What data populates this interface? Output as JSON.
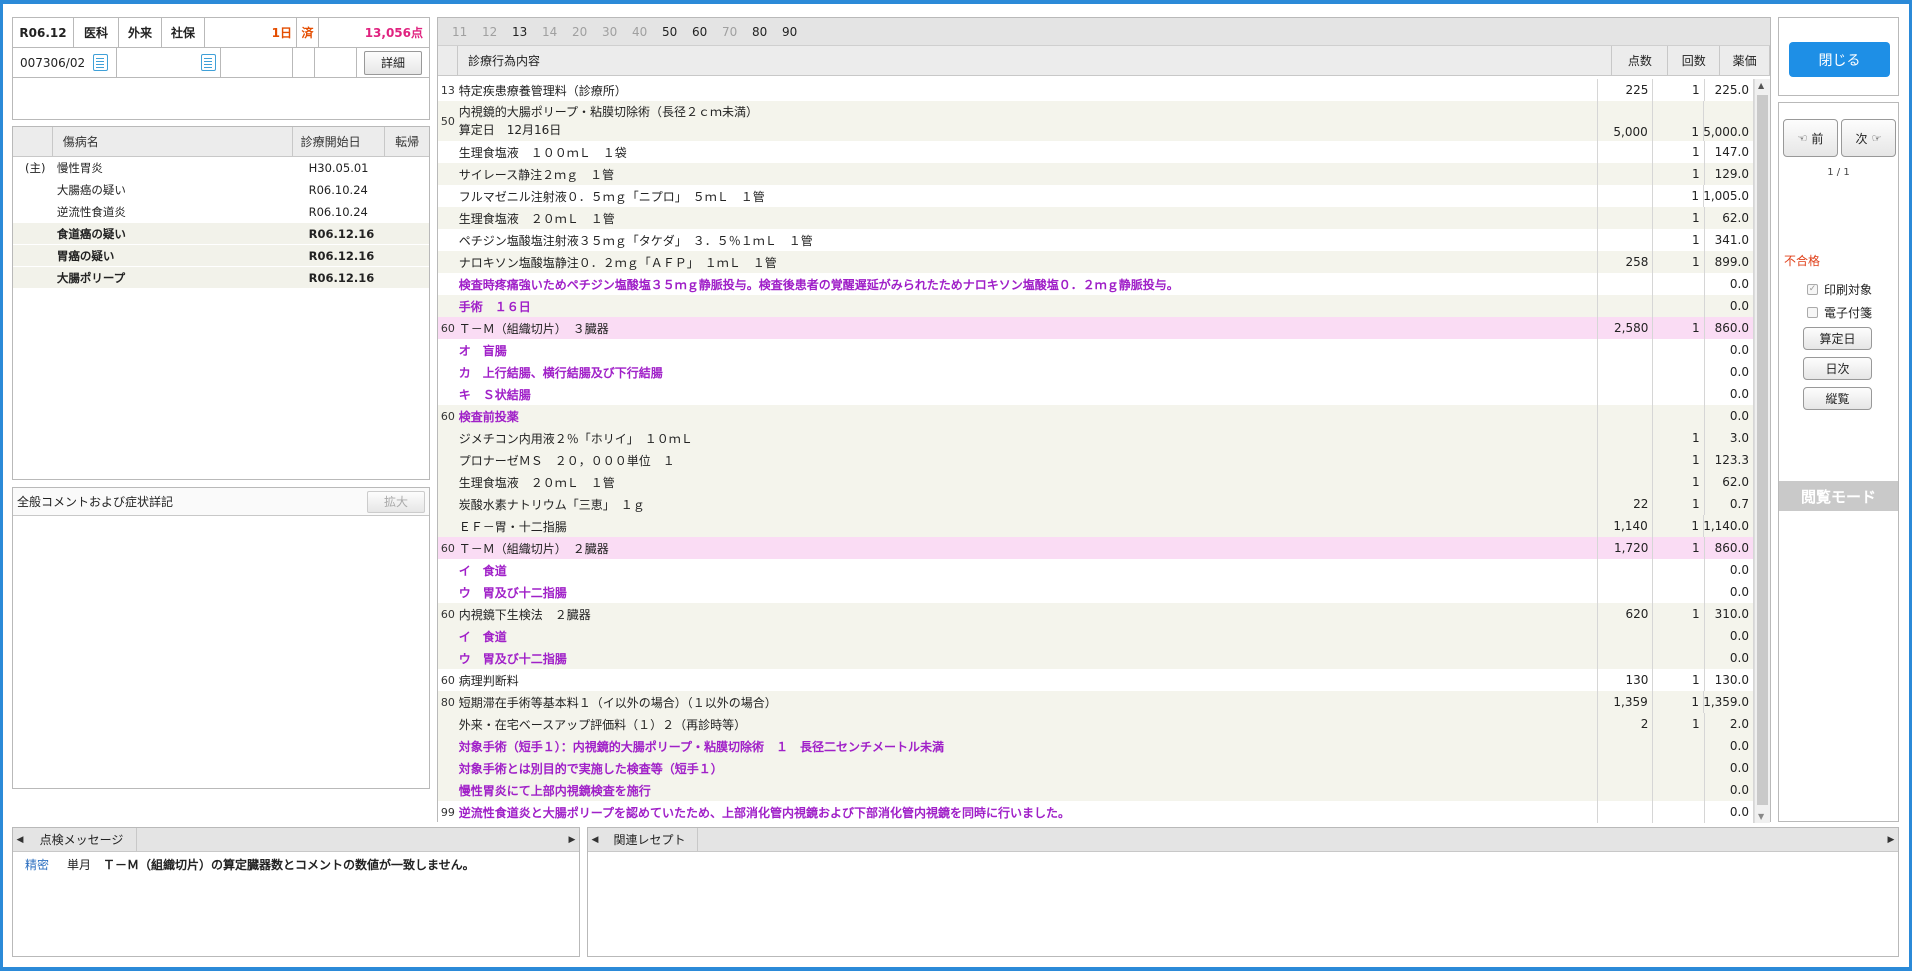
{
  "header": {
    "date": "R06.12",
    "dept": "医科",
    "type": "外来",
    "insurance": "社保",
    "days": "1日",
    "status": "済",
    "points": "13,056点",
    "patient_id": "007306/02",
    "detail_button": "詳細"
  },
  "disease_panel": {
    "col_name": "傷病名",
    "col_start": "診療開始日",
    "col_outcome": "転帰",
    "rows": [
      {
        "main": "(主)",
        "name": "慢性胃炎",
        "date": "H30.05.01",
        "bold": false
      },
      {
        "main": "",
        "name": "大腸癌の疑い",
        "date": "R06.10.24",
        "bold": false
      },
      {
        "main": "",
        "name": "逆流性食道炎",
        "date": "R06.10.24",
        "bold": false
      },
      {
        "main": "",
        "name": "食道癌の疑い",
        "date": "R06.12.16",
        "bold": true
      },
      {
        "main": "",
        "name": "胃癌の疑い",
        "date": "R06.12.16",
        "bold": true
      },
      {
        "main": "",
        "name": "大腸ポリープ",
        "date": "R06.12.16",
        "bold": true
      }
    ]
  },
  "comment_panel": {
    "title": "全般コメントおよび症状詳記",
    "expand_button": "拡大"
  },
  "day_tabs": [
    "11",
    "12",
    "13",
    "14",
    "20",
    "30",
    "40",
    "50",
    "60",
    "70",
    "80",
    "90"
  ],
  "main_table": {
    "col_content": "診療行為内容",
    "col_points": "点数",
    "col_count": "回数",
    "col_price": "薬価",
    "rows": [
      {
        "code": "13",
        "text": "特定疾患療養管理料（診療所）",
        "line2": "",
        "pts": "225",
        "cnt": "1",
        "price": "225.0",
        "style": "b",
        "comment": false
      },
      {
        "code": "50",
        "text": "内視鏡的大腸ポリープ・粘膜切除術（長径２ｃｍ未満）",
        "line2": "算定日　12月16日",
        "pts": "5,000",
        "cnt": "1",
        "price": "5,000.0",
        "style": "a",
        "comment": false
      },
      {
        "code": "",
        "text": "生理食塩液　１００ｍＬ　１袋",
        "line2": "",
        "pts": "",
        "cnt": "1",
        "price": "147.0",
        "style": "b",
        "comment": false
      },
      {
        "code": "",
        "text": "サイレース静注２ｍｇ　１管",
        "line2": "",
        "pts": "",
        "cnt": "1",
        "price": "129.0",
        "style": "a",
        "comment": false
      },
      {
        "code": "",
        "text": "フルマゼニル注射液０．５ｍｇ「ニプロ」　５ｍＬ　１管",
        "line2": "",
        "pts": "",
        "cnt": "1",
        "price": "1,005.0",
        "style": "b",
        "comment": false
      },
      {
        "code": "",
        "text": "生理食塩液　２０ｍＬ　１管",
        "line2": "",
        "pts": "",
        "cnt": "1",
        "price": "62.0",
        "style": "a",
        "comment": false
      },
      {
        "code": "",
        "text": "ペチジン塩酸塩注射液３５ｍｇ「タケダ」　３．５％１ｍＬ　１管",
        "line2": "",
        "pts": "",
        "cnt": "1",
        "price": "341.0",
        "style": "b",
        "comment": false
      },
      {
        "code": "",
        "text": "ナロキソン塩酸塩静注０．２ｍｇ「ＡＦＰ」　１ｍＬ　１管",
        "line2": "",
        "pts": "258",
        "cnt": "1",
        "price": "899.0",
        "style": "a",
        "comment": false
      },
      {
        "code": "",
        "text": "検査時疼痛強いためペチジン塩酸塩３５ｍｇ静脈投与。検査後患者の覚醒遅延がみられたためナロキソン塩酸塩０．２ｍｇ静脈投与。",
        "line2": "",
        "pts": "",
        "cnt": "",
        "price": "0.0",
        "style": "b",
        "comment": true
      },
      {
        "code": "",
        "text": "手術　１６日",
        "line2": "",
        "pts": "",
        "cnt": "",
        "price": "0.0",
        "style": "a",
        "comment": true
      },
      {
        "code": "60",
        "text": "Ｔ－Ｍ（組織切片）　３臓器",
        "line2": "",
        "pts": "2,580",
        "cnt": "1",
        "price": "860.0",
        "style": "p",
        "comment": false
      },
      {
        "code": "",
        "text": "オ　盲腸",
        "line2": "",
        "pts": "",
        "cnt": "",
        "price": "0.0",
        "style": "b",
        "comment": true
      },
      {
        "code": "",
        "text": "カ　上行結腸、横行結腸及び下行結腸",
        "line2": "",
        "pts": "",
        "cnt": "",
        "price": "0.0",
        "style": "b",
        "comment": true
      },
      {
        "code": "",
        "text": "キ　Ｓ状結腸",
        "line2": "",
        "pts": "",
        "cnt": "",
        "price": "0.0",
        "style": "b",
        "comment": true
      },
      {
        "code": "60",
        "text": "検査前投薬",
        "line2": "",
        "pts": "",
        "cnt": "",
        "price": "0.0",
        "style": "a",
        "comment": true
      },
      {
        "code": "",
        "text": "ジメチコン内用液２％「ホリイ」　１０ｍＬ",
        "line2": "",
        "pts": "",
        "cnt": "1",
        "price": "3.0",
        "style": "a",
        "comment": false
      },
      {
        "code": "",
        "text": "プロナーゼＭＳ　２０，０００単位　１",
        "line2": "",
        "pts": "",
        "cnt": "1",
        "price": "123.3",
        "style": "a",
        "comment": false
      },
      {
        "code": "",
        "text": "生理食塩液　２０ｍＬ　１管",
        "line2": "",
        "pts": "",
        "cnt": "1",
        "price": "62.0",
        "style": "a",
        "comment": false
      },
      {
        "code": "",
        "text": "炭酸水素ナトリウム「三恵」　１ｇ",
        "line2": "",
        "pts": "22",
        "cnt": "1",
        "price": "0.7",
        "style": "a",
        "comment": false
      },
      {
        "code": "",
        "text": "ＥＦ－胃・十二指腸",
        "line2": "",
        "pts": "1,140",
        "cnt": "1",
        "price": "1,140.0",
        "style": "a",
        "comment": false
      },
      {
        "code": "60",
        "text": "Ｔ－Ｍ（組織切片）　２臓器",
        "line2": "",
        "pts": "1,720",
        "cnt": "1",
        "price": "860.0",
        "style": "p",
        "comment": false
      },
      {
        "code": "",
        "text": "イ　食道",
        "line2": "",
        "pts": "",
        "cnt": "",
        "price": "0.0",
        "style": "b",
        "comment": true
      },
      {
        "code": "",
        "text": "ウ　胃及び十二指腸",
        "line2": "",
        "pts": "",
        "cnt": "",
        "price": "0.0",
        "style": "b",
        "comment": true
      },
      {
        "code": "60",
        "text": "内視鏡下生検法　２臓器",
        "line2": "",
        "pts": "620",
        "cnt": "1",
        "price": "310.0",
        "style": "a",
        "comment": false
      },
      {
        "code": "",
        "text": "イ　食道",
        "line2": "",
        "pts": "",
        "cnt": "",
        "price": "0.0",
        "style": "a",
        "comment": true
      },
      {
        "code": "",
        "text": "ウ　胃及び十二指腸",
        "line2": "",
        "pts": "",
        "cnt": "",
        "price": "0.0",
        "style": "a",
        "comment": true
      },
      {
        "code": "60",
        "text": "病理判断料",
        "line2": "",
        "pts": "130",
        "cnt": "1",
        "price": "130.0",
        "style": "b",
        "comment": false
      },
      {
        "code": "80",
        "text": "短期滞在手術等基本料１（イ以外の場合）（１以外の場合）",
        "line2": "",
        "pts": "1,359",
        "cnt": "1",
        "price": "1,359.0",
        "style": "a",
        "comment": false
      },
      {
        "code": "",
        "text": "外来・在宅ベースアップ評価料（１）２（再診時等）",
        "line2": "",
        "pts": "2",
        "cnt": "1",
        "price": "2.0",
        "style": "a",
        "comment": false
      },
      {
        "code": "",
        "text": "対象手術（短手１）：内視鏡的大腸ポリープ・粘膜切除術　１　長径二センチメートル未満",
        "line2": "",
        "pts": "",
        "cnt": "",
        "price": "0.0",
        "style": "a",
        "comment": true
      },
      {
        "code": "",
        "text": "対象手術とは別目的で実施した検査等（短手１）",
        "line2": "",
        "pts": "",
        "cnt": "",
        "price": "0.0",
        "style": "a",
        "comment": true
      },
      {
        "code": "",
        "text": "慢性胃炎にて上部内視鏡検査を施行",
        "line2": "",
        "pts": "",
        "cnt": "",
        "price": "0.0",
        "style": "a",
        "comment": true
      },
      {
        "code": "99",
        "text": "逆流性食道炎と大腸ポリープを認めていたため、上部消化管内視鏡および下部消化管内視鏡を同時に行いました。",
        "line2": "",
        "pts": "",
        "cnt": "",
        "price": "0.0",
        "style": "b",
        "comment": true
      }
    ]
  },
  "right_panel": {
    "close_button": "閉じる",
    "prev_button": "前",
    "next_button": "次",
    "page": "1 / 1",
    "status": "不合格",
    "print_target": "印刷対象",
    "e_attach": "電子付箋",
    "calc_date_button": "算定日",
    "daily_button": "日次",
    "vertical_button": "縦覧",
    "mode_label": "閲覧モード"
  },
  "bottom_left": {
    "tab": "点検メッセージ",
    "msg_level": "精密",
    "msg_type": "単月",
    "msg_text": "Ｔ－Ｍ（組織切片）の算定臓器数とコメントの数値が一致しません。"
  },
  "bottom_right": {
    "tab": "関連レセプト"
  }
}
